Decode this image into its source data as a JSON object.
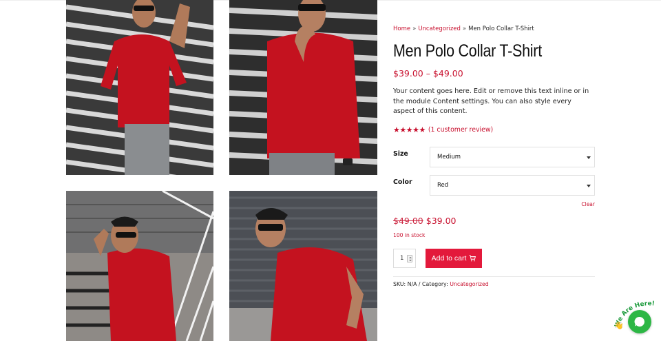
{
  "breadcrumb": {
    "home": "Home",
    "sep1": "»",
    "category": "Uncategorized",
    "sep2": "»",
    "current": "Men Polo Collar T-Shirt"
  },
  "product": {
    "title": "Men Polo Collar T-Shirt",
    "price_range": "$39.00 – $49.00",
    "description": "Your content goes here. Edit or remove this text inline or in the module Content settings. You can also style every aspect of this content.",
    "rating_stars": "★★★★★",
    "rating_value": 5,
    "review_link": "(1 customer review)"
  },
  "variations": {
    "size_label": "Size",
    "size_value": "Medium",
    "color_label": "Color",
    "color_value": "Red",
    "clear_label": "Clear"
  },
  "variation_price": {
    "regular": "$49.00",
    "sale": "$39.00",
    "stock": "100 in stock"
  },
  "cart": {
    "quantity": "1",
    "button_label": "Add to cart",
    "button_icon": "cart-icon"
  },
  "meta": {
    "sku_text": "SKU: N/A / Category:",
    "category_link": "Uncategorized"
  },
  "gallery": [
    {
      "name": "product-photo-1",
      "caption": ""
    },
    {
      "name": "product-photo-2",
      "caption": ""
    },
    {
      "name": "product-photo-3",
      "caption": ""
    },
    {
      "name": "product-photo-4",
      "caption": ""
    }
  ],
  "chat": {
    "text": "We Are Here!",
    "icon": "chat-bubble-icon"
  },
  "colors": {
    "accent": "#c8102e",
    "button": "#e3193b",
    "chat": "#2db745",
    "shirt": "#c4121f"
  }
}
